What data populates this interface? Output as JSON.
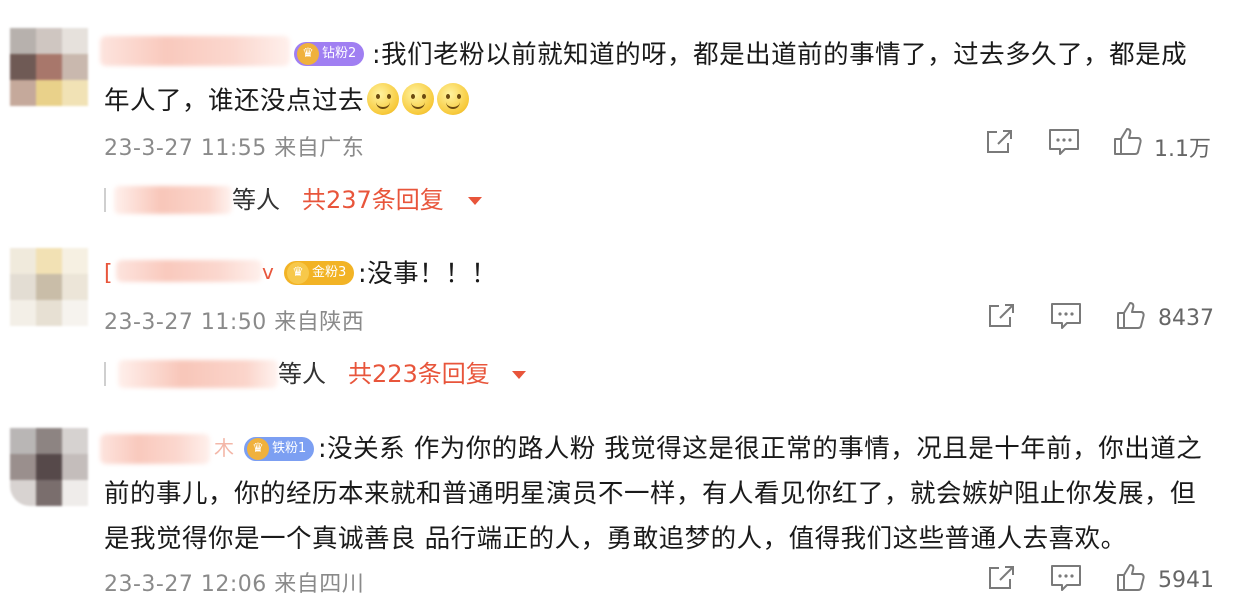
{
  "comments": [
    {
      "badge": "钻粉2",
      "badge_color": "#9b7df0",
      "text_line1": ":我们老粉以前就知道的呀，都是出道前的事情了，过去多久了，都是成",
      "text_line2": "年人了，谁还没点过去",
      "time": "23-3-27 11:55 来自广东",
      "likes": "1.1万",
      "replies_deng": "等人",
      "replies_total": "共237条回复"
    },
    {
      "name_prefix": "[",
      "name_suffix": "v",
      "badge": "金粉3",
      "badge_color": "#f2b325",
      "text_line1": ":没事！！！",
      "time": "23-3-27 11:50 来自陕西",
      "likes": "8437",
      "replies_deng": "等人",
      "replies_total": "共223条回复"
    },
    {
      "name_suffix": "木",
      "badge": "铁粉1",
      "badge_color": "#7b9ff0",
      "text_line1": ":没关系 作为你的路人粉 我觉得这是很正常的事情，况且是十年前，你出道之",
      "text_line2": "前的事儿，你的经历本来就和普通明星演员不一样，有人看见你红了，就会嫉妒阻止你发展，但",
      "text_line3": "是我觉得你是一个真诚善良 品行端正的人，勇敢追梦的人，值得我们这些普通人去喜欢。",
      "time": "23-3-27 12:06 来自四川",
      "likes": "5941"
    }
  ],
  "icons": {
    "share": "share-icon",
    "comment": "comment-icon",
    "like": "thumbs-up-icon",
    "caret": "caret-down-icon",
    "emoji": "smile-emoji-icon"
  },
  "colors": {
    "reply_link": "#e8553b",
    "meta_gray": "#8a8a8a"
  }
}
